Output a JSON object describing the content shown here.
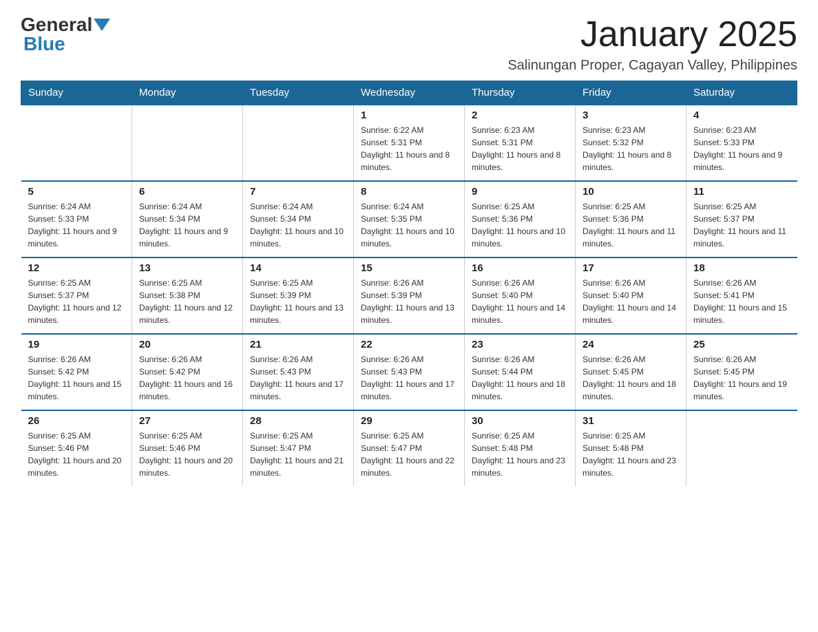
{
  "logo": {
    "general": "General",
    "blue": "Blue"
  },
  "header": {
    "month": "January 2025",
    "location": "Salinungan Proper, Cagayan Valley, Philippines"
  },
  "weekdays": [
    "Sunday",
    "Monday",
    "Tuesday",
    "Wednesday",
    "Thursday",
    "Friday",
    "Saturday"
  ],
  "weeks": [
    [
      {
        "day": "",
        "info": ""
      },
      {
        "day": "",
        "info": ""
      },
      {
        "day": "",
        "info": ""
      },
      {
        "day": "1",
        "info": "Sunrise: 6:22 AM\nSunset: 5:31 PM\nDaylight: 11 hours and 8 minutes."
      },
      {
        "day": "2",
        "info": "Sunrise: 6:23 AM\nSunset: 5:31 PM\nDaylight: 11 hours and 8 minutes."
      },
      {
        "day": "3",
        "info": "Sunrise: 6:23 AM\nSunset: 5:32 PM\nDaylight: 11 hours and 8 minutes."
      },
      {
        "day": "4",
        "info": "Sunrise: 6:23 AM\nSunset: 5:33 PM\nDaylight: 11 hours and 9 minutes."
      }
    ],
    [
      {
        "day": "5",
        "info": "Sunrise: 6:24 AM\nSunset: 5:33 PM\nDaylight: 11 hours and 9 minutes."
      },
      {
        "day": "6",
        "info": "Sunrise: 6:24 AM\nSunset: 5:34 PM\nDaylight: 11 hours and 9 minutes."
      },
      {
        "day": "7",
        "info": "Sunrise: 6:24 AM\nSunset: 5:34 PM\nDaylight: 11 hours and 10 minutes."
      },
      {
        "day": "8",
        "info": "Sunrise: 6:24 AM\nSunset: 5:35 PM\nDaylight: 11 hours and 10 minutes."
      },
      {
        "day": "9",
        "info": "Sunrise: 6:25 AM\nSunset: 5:36 PM\nDaylight: 11 hours and 10 minutes."
      },
      {
        "day": "10",
        "info": "Sunrise: 6:25 AM\nSunset: 5:36 PM\nDaylight: 11 hours and 11 minutes."
      },
      {
        "day": "11",
        "info": "Sunrise: 6:25 AM\nSunset: 5:37 PM\nDaylight: 11 hours and 11 minutes."
      }
    ],
    [
      {
        "day": "12",
        "info": "Sunrise: 6:25 AM\nSunset: 5:37 PM\nDaylight: 11 hours and 12 minutes."
      },
      {
        "day": "13",
        "info": "Sunrise: 6:25 AM\nSunset: 5:38 PM\nDaylight: 11 hours and 12 minutes."
      },
      {
        "day": "14",
        "info": "Sunrise: 6:25 AM\nSunset: 5:39 PM\nDaylight: 11 hours and 13 minutes."
      },
      {
        "day": "15",
        "info": "Sunrise: 6:26 AM\nSunset: 5:39 PM\nDaylight: 11 hours and 13 minutes."
      },
      {
        "day": "16",
        "info": "Sunrise: 6:26 AM\nSunset: 5:40 PM\nDaylight: 11 hours and 14 minutes."
      },
      {
        "day": "17",
        "info": "Sunrise: 6:26 AM\nSunset: 5:40 PM\nDaylight: 11 hours and 14 minutes."
      },
      {
        "day": "18",
        "info": "Sunrise: 6:26 AM\nSunset: 5:41 PM\nDaylight: 11 hours and 15 minutes."
      }
    ],
    [
      {
        "day": "19",
        "info": "Sunrise: 6:26 AM\nSunset: 5:42 PM\nDaylight: 11 hours and 15 minutes."
      },
      {
        "day": "20",
        "info": "Sunrise: 6:26 AM\nSunset: 5:42 PM\nDaylight: 11 hours and 16 minutes."
      },
      {
        "day": "21",
        "info": "Sunrise: 6:26 AM\nSunset: 5:43 PM\nDaylight: 11 hours and 17 minutes."
      },
      {
        "day": "22",
        "info": "Sunrise: 6:26 AM\nSunset: 5:43 PM\nDaylight: 11 hours and 17 minutes."
      },
      {
        "day": "23",
        "info": "Sunrise: 6:26 AM\nSunset: 5:44 PM\nDaylight: 11 hours and 18 minutes."
      },
      {
        "day": "24",
        "info": "Sunrise: 6:26 AM\nSunset: 5:45 PM\nDaylight: 11 hours and 18 minutes."
      },
      {
        "day": "25",
        "info": "Sunrise: 6:26 AM\nSunset: 5:45 PM\nDaylight: 11 hours and 19 minutes."
      }
    ],
    [
      {
        "day": "26",
        "info": "Sunrise: 6:25 AM\nSunset: 5:46 PM\nDaylight: 11 hours and 20 minutes."
      },
      {
        "day": "27",
        "info": "Sunrise: 6:25 AM\nSunset: 5:46 PM\nDaylight: 11 hours and 20 minutes."
      },
      {
        "day": "28",
        "info": "Sunrise: 6:25 AM\nSunset: 5:47 PM\nDaylight: 11 hours and 21 minutes."
      },
      {
        "day": "29",
        "info": "Sunrise: 6:25 AM\nSunset: 5:47 PM\nDaylight: 11 hours and 22 minutes."
      },
      {
        "day": "30",
        "info": "Sunrise: 6:25 AM\nSunset: 5:48 PM\nDaylight: 11 hours and 23 minutes."
      },
      {
        "day": "31",
        "info": "Sunrise: 6:25 AM\nSunset: 5:48 PM\nDaylight: 11 hours and 23 minutes."
      },
      {
        "day": "",
        "info": ""
      }
    ]
  ]
}
